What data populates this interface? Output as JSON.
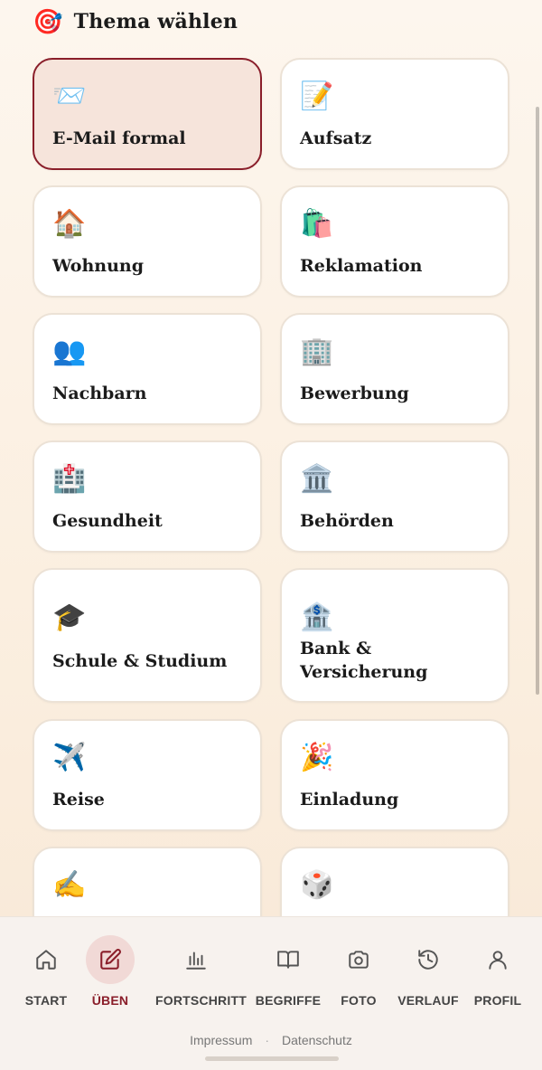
{
  "header": {
    "icon": "🎯",
    "icon_name": "target-icon",
    "title": "Thema wählen"
  },
  "topics": [
    {
      "label": "E-Mail formal",
      "icon": "📨",
      "icon_name": "envelope-icon",
      "selected": true
    },
    {
      "label": "Aufsatz",
      "icon": "📝",
      "icon_name": "memo-icon",
      "selected": false
    },
    {
      "label": "Wohnung",
      "icon": "🏠",
      "icon_name": "house-icon",
      "selected": false
    },
    {
      "label": "Reklamation",
      "icon": "🛍️",
      "icon_name": "shopping-bags-icon",
      "selected": false
    },
    {
      "label": "Nachbarn",
      "icon": "👥",
      "icon_name": "people-icon",
      "selected": false
    },
    {
      "label": "Bewerbung",
      "icon": "🏢",
      "icon_name": "office-building-icon",
      "selected": false
    },
    {
      "label": "Gesundheit",
      "icon": "🏥",
      "icon_name": "hospital-icon",
      "selected": false
    },
    {
      "label": "Behörden",
      "icon": "🏛️",
      "icon_name": "classical-building-icon",
      "selected": false
    },
    {
      "label": "Schule & Studium",
      "icon": "🎓",
      "icon_name": "graduation-cap-icon",
      "selected": false
    },
    {
      "label": "Bank & Versicherung",
      "icon": "🏦",
      "icon_name": "bank-icon",
      "selected": false
    },
    {
      "label": "Reise",
      "icon": "✈️",
      "icon_name": "airplane-icon",
      "selected": false
    },
    {
      "label": "Einladung",
      "icon": "🎉",
      "icon_name": "party-popper-icon",
      "selected": false
    },
    {
      "label": "",
      "icon": "✍️",
      "icon_name": "writing-hand-icon",
      "selected": false
    },
    {
      "label": "",
      "icon": "🎲",
      "icon_name": "dice-icon",
      "selected": false
    }
  ],
  "nav": [
    {
      "label": "START",
      "icon_name": "home-icon",
      "active": false
    },
    {
      "label": "ÜBEN",
      "icon_name": "edit-icon",
      "active": true
    },
    {
      "label": "FORTSCHRITT",
      "icon_name": "bar-chart-icon",
      "active": false
    },
    {
      "label": "BEGRIFFE",
      "icon_name": "book-icon",
      "active": false
    },
    {
      "label": "FOTO",
      "icon_name": "camera-icon",
      "active": false
    },
    {
      "label": "VERLAUF",
      "icon_name": "history-icon",
      "active": false
    },
    {
      "label": "PROFIL",
      "icon_name": "user-icon",
      "active": false
    }
  ],
  "footer": {
    "impressum": "Impressum",
    "separator": "·",
    "datenschutz": "Datenschutz"
  },
  "colors": {
    "accent": "#8a1e2a",
    "card_selected_bg": "#f6e4db",
    "card_bg": "#ffffff"
  }
}
